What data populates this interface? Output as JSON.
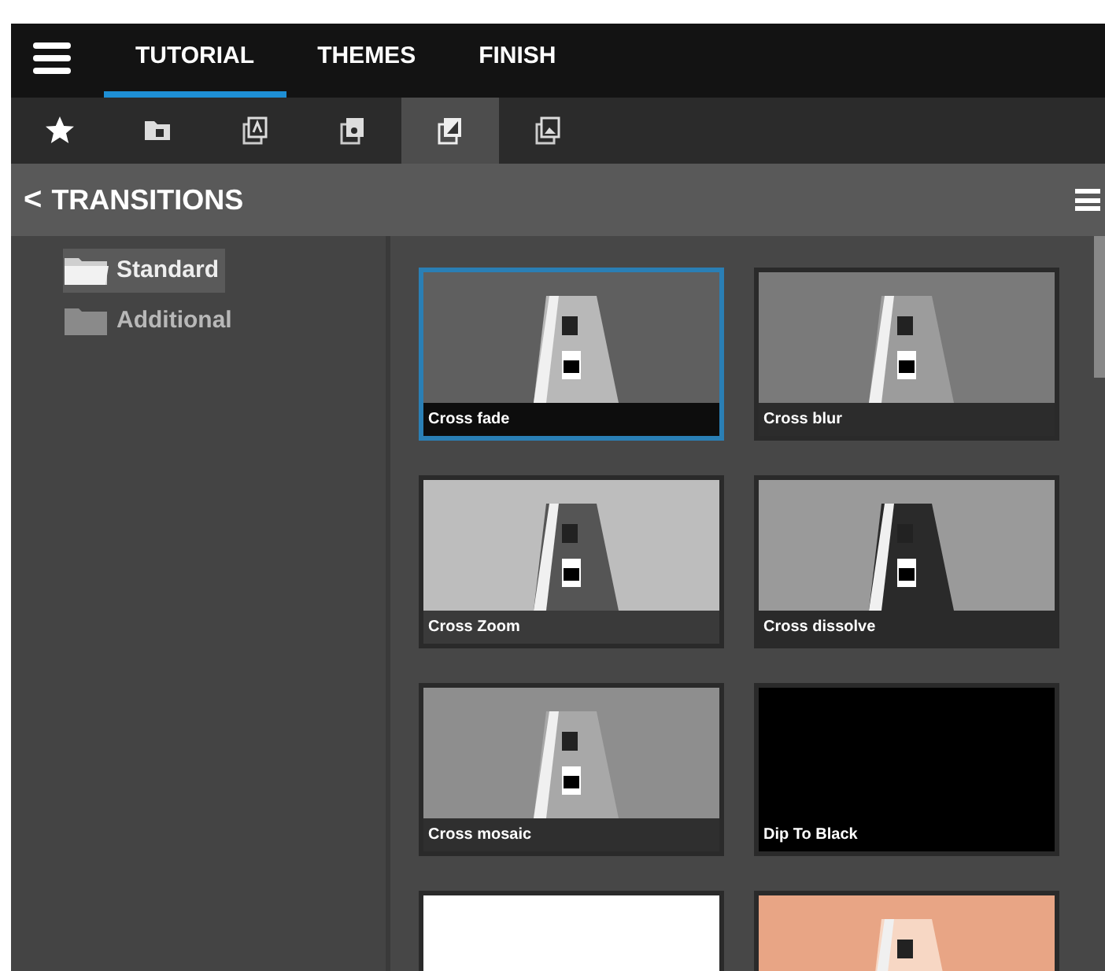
{
  "top_tabs": [
    {
      "label": "TUTORIAL",
      "selected": true
    },
    {
      "label": "THEMES",
      "selected": false
    },
    {
      "label": "FINISH",
      "selected": false
    }
  ],
  "icon_tabs": [
    {
      "selected": false
    },
    {
      "selected": false
    },
    {
      "selected": false
    },
    {
      "selected": false
    },
    {
      "selected": true
    },
    {
      "selected": false
    }
  ],
  "header": {
    "back": "<",
    "title": "TRANSITIONS"
  },
  "folders": [
    {
      "label": "Standard",
      "selected": true
    },
    {
      "label": "Additional",
      "selected": false
    }
  ],
  "transitions": [
    {
      "label": "Cross fade",
      "selected": true
    },
    {
      "label": "Cross blur",
      "selected": false
    },
    {
      "label": "Cross Zoom",
      "selected": false
    },
    {
      "label": "Cross dissolve",
      "selected": false
    },
    {
      "label": "Cross mosaic",
      "selected": false
    },
    {
      "label": "Dip To Black",
      "selected": false
    },
    {
      "selected": false
    },
    {
      "selected": false
    }
  ]
}
